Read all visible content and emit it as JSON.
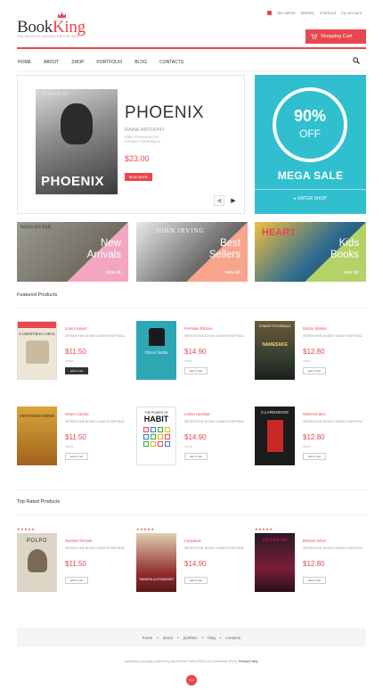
{
  "header": {
    "top_links": [
      "site admin",
      "delivery",
      "checkout",
      "my account"
    ],
    "logo_book": "Book",
    "logo_king": "King",
    "tagline": "THE BIGGEST CHOICE ON THE WEB",
    "cart_label": "Shopping Cart",
    "accent": "#e8474f"
  },
  "nav": {
    "items": [
      "HOME",
      "ABOUT",
      "SHOP",
      "PORTFOLIO",
      "BLOG",
      "CONTACTS"
    ]
  },
  "hero": {
    "cover_label_top": "A NOVEL BY",
    "cover_title": "PHOENIX",
    "title": "PHOENIX",
    "author": "RAINE ANTHONY",
    "isbn": "ISBN: 9781941062700",
    "format": "FORMAT: PAPERBACK",
    "price": "$23.00",
    "more_label": "READ MORE"
  },
  "sale": {
    "percent": "90%",
    "off": "OFF",
    "title": "MEGA SALE",
    "link": "ENTER SHOP",
    "color": "#30bfcf"
  },
  "banners": [
    {
      "title": "New\nArrivals",
      "link": "view all",
      "color": "#f3a6c1"
    },
    {
      "title": "Best\nSellers",
      "link": "view all",
      "color": "#f8a58d"
    },
    {
      "title": "Kids\nBooks",
      "link": "view all",
      "color": "#b4d267"
    }
  ],
  "featured": {
    "heading": "Featured Products",
    "products": [
      {
        "name": "Lorem Ipsum",
        "desc": "ЛЕРАЕНТНИЕ ВООКЕ ПАКНЕТИ ВЕРНЕАС",
        "price": "$11.50",
        "details": "details",
        "btn": "add to cart"
      },
      {
        "name": "Fermitae Rilocus",
        "desc": "ЛЕРАЕНТНИЕ ВООКЕ ПАКНЕТИ ВЕРНЕАС",
        "price": "$14.90",
        "details": "details",
        "btn": "add to cart"
      },
      {
        "name": "Dolore Sitame",
        "desc": "ЛЕРАЕНТНИЕ ВООКЕ ПАКНЕТИ ВЕРНЕАС",
        "price": "$12.80",
        "details": "details",
        "btn": "add to cart"
      },
      {
        "name": "Velure Caenta",
        "desc": "ЛЕРАЕНТНИЕ ВООКЕ ПАКНЕТИ ВЕРНЕАС",
        "price": "$11.50",
        "details": "details",
        "btn": "add to cart"
      },
      {
        "name": "Letrea Haoritas",
        "desc": "ЛЕРАЕНТНИЕ ВООКЕ ПАКНЕТИ ВЕРНЕАС",
        "price": "$14.90",
        "details": "details",
        "btn": "add to cart"
      },
      {
        "name": "Winterus Mox",
        "desc": "ЛЕРАЕНТНИЕ ВООКЕ ПАКНЕТИ ВЕРНЕАС",
        "price": "$12.80",
        "details": "details",
        "btn": "add to cart"
      }
    ]
  },
  "top_rated": {
    "heading": "Top Rated Products",
    "products": [
      {
        "name": "Doertas Geriyas",
        "desc": "ЛЕРАЕНТНИЕ ВООКЕ ПАКНЕТИ ВЕРНЕАС",
        "price": "$11.50",
        "btn": "add to cart",
        "stars": "★★★★★"
      },
      {
        "name": "Cariyasue",
        "desc": "ЛЕРАЕНТНИЕ ВООКЕ ПАКНЕТИ ВЕРНЕАС",
        "price": "$14.90",
        "btn": "add to cart",
        "stars": "★★★★★"
      },
      {
        "name": "Beriyus Holos",
        "desc": "ЛЕРАЕНТНИЕ ВООКЕ ПАКНЕТИ ВЕРНЕАС",
        "price": "$12.80",
        "btn": "add to cart",
        "stars": "★★★★★"
      }
    ]
  },
  "covers": {
    "c1": "A CHRISTMAS CAROL",
    "c2_title": "Oliver Sacks",
    "c3_title": "NAMESAKE",
    "c3_author": "CONOR FITZGERALD",
    "c4_title": "UNFINISHED EMPIRE",
    "c5_a": "THE POWER OF",
    "c5_b": "HABIT",
    "c6_title": "CLARENDON",
    "c7_title": "POLPO",
    "c8_title": "TAMERA ALEXANDER",
    "c9_title": "DIE FOR ME"
  },
  "banner_covers": {
    "b1": "WAGS ITS TAIL",
    "b2": "JOHN IRVING",
    "b3": "HEART"
  },
  "footer": {
    "nav": [
      "home",
      "about",
      "portfolio",
      "blog",
      "contacts"
    ],
    "sep": "•",
    "copyright": "BookKing is proudly powered by WordPress Entries (RSS) and Comments (RSS).",
    "policy": "Privacy Policy",
    "top": "TOP"
  }
}
